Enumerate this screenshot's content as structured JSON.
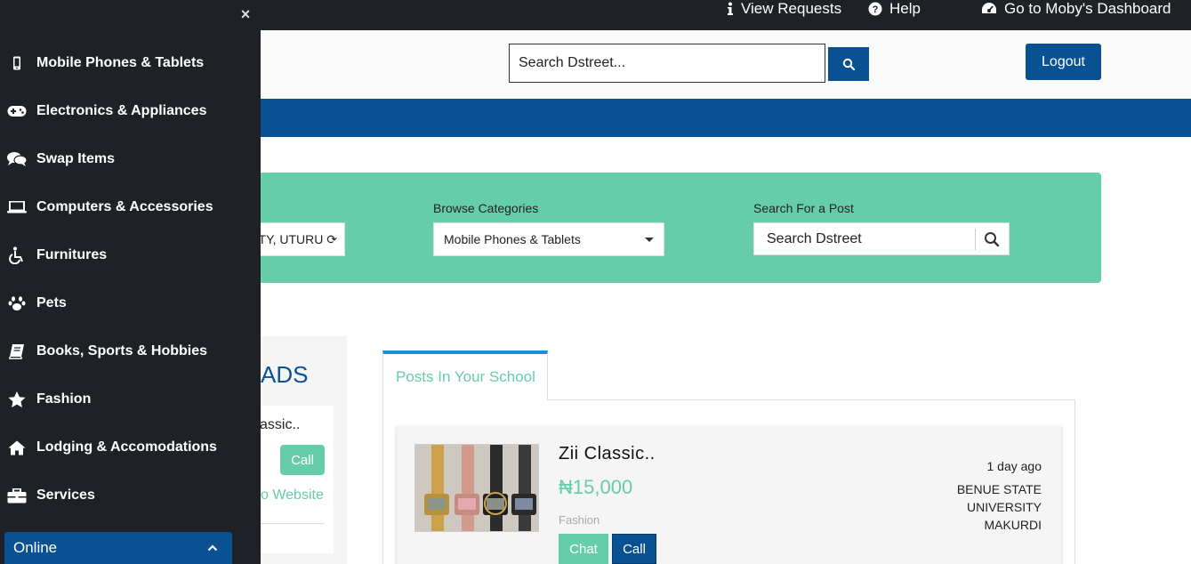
{
  "topbar": {
    "view_requests": "View Requests",
    "help": "Help",
    "dashboard": "Go to Moby's Dashboard"
  },
  "header": {
    "search_placeholder": "Search Dstreet...",
    "logout": "Logout"
  },
  "filters": {
    "school_value": "TY, UTURU ⟳",
    "categories_label": "Browse Categories",
    "category_value": "Mobile Phones & Tablets",
    "search_label": "Search For a Post",
    "search_placeholder": "Search Dstreet"
  },
  "ads": {
    "title": "ADS",
    "item_title": "assic..",
    "call": "Call",
    "website": "o Website"
  },
  "tabs": {
    "active": "Posts In Your School"
  },
  "post": {
    "title": "Zii Classic..",
    "price": "₦15,000",
    "category": "Fashion",
    "chat": "Chat",
    "call": "Call",
    "time": "1 day ago",
    "location_lines": [
      "BENUE STATE",
      "UNIVERSITY",
      "MAKURDI"
    ]
  },
  "sidebar": {
    "close": "×",
    "items": [
      {
        "label": "Mobile Phones & Tablets",
        "icon": "mobile-icon"
      },
      {
        "label": "Electronics & Appliances",
        "icon": "gamepad-icon"
      },
      {
        "label": "Swap Items",
        "icon": "comments-icon"
      },
      {
        "label": "Computers & Accessories",
        "icon": "laptop-icon"
      },
      {
        "label": "Furnitures",
        "icon": "wheelchair-icon"
      },
      {
        "label": "Pets",
        "icon": "paw-icon"
      },
      {
        "label": "Books, Sports & Hobbies",
        "icon": "book-icon"
      },
      {
        "label": "Fashion",
        "icon": "star-icon"
      },
      {
        "label": "Lodging & Accomodations",
        "icon": "home-icon"
      },
      {
        "label": "Services",
        "icon": "briefcase-icon"
      }
    ],
    "online": "Online"
  },
  "colors": {
    "dark": "#1e2226",
    "brand_blue": "#0a5194",
    "mint": "#66cdaa",
    "tab_accent": "#1a8ed6"
  }
}
